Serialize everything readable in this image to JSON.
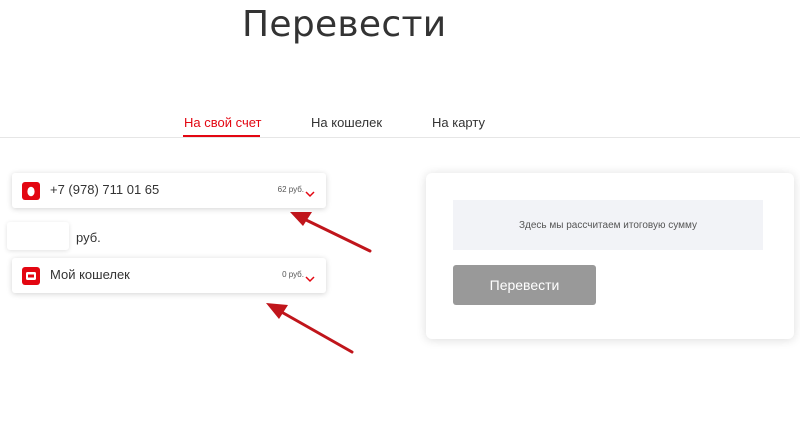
{
  "page": {
    "title": "Перевести"
  },
  "tabs": [
    {
      "label": "На свой счет",
      "active": true
    },
    {
      "label": "На кошелек",
      "active": false
    },
    {
      "label": "На карту",
      "active": false
    }
  ],
  "source": {
    "label": "+7 (978) 711 01 65",
    "balance": "62 руб.",
    "icon": "mts-sim-icon"
  },
  "amount": {
    "value": "",
    "placeholder": "",
    "currency": "руб."
  },
  "destination": {
    "label": "Мой кошелек",
    "balance": "0 руб.",
    "icon": "wallet-icon"
  },
  "summary": {
    "text": "Здесь мы рассчитаем итоговую сумму",
    "submit_label": "Перевести"
  },
  "colors": {
    "accent": "#e30611",
    "button_disabled": "#999999",
    "annotation_arrow": "#c0151b"
  }
}
